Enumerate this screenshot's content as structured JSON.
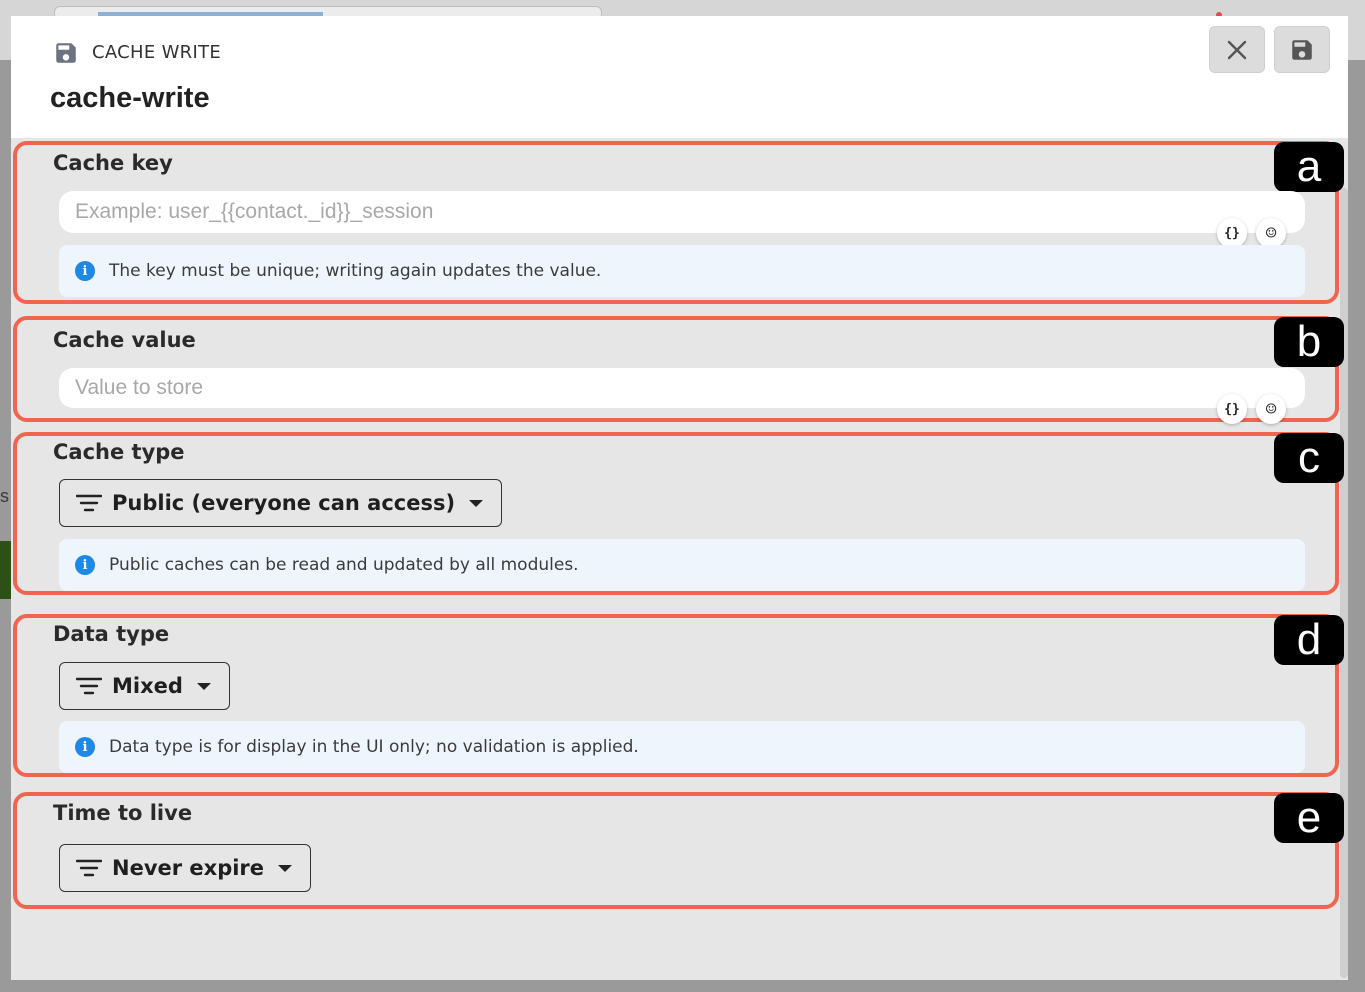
{
  "header": {
    "kicker": "CACHE WRITE",
    "title": "cache-write"
  },
  "sections": {
    "cache_key": {
      "badge": "a",
      "label": "Cache key",
      "placeholder": "Example: user_{{contact._id}}_session",
      "value": "",
      "info": "The key must be unique; writing again updates the value."
    },
    "cache_value": {
      "badge": "b",
      "label": "Cache value",
      "placeholder": "Value to store",
      "value": ""
    },
    "cache_type": {
      "badge": "c",
      "label": "Cache type",
      "selected": "Public (everyone can access)",
      "info": "Public caches can be read and updated by all modules."
    },
    "data_type": {
      "badge": "d",
      "label": "Data type",
      "selected": "Mixed",
      "info": "Data type is for display in the UI only; no validation is applied."
    },
    "time_to_live": {
      "badge": "e",
      "label": "Time to live",
      "selected": "Never expire"
    }
  },
  "mini_buttons": {
    "variable": "{}",
    "emoji": "☺"
  },
  "icons": {
    "header": "floppy-disk-icon",
    "close": "close-icon",
    "save": "floppy-disk-icon",
    "info": "info-icon",
    "filter": "filter-icon",
    "caret": "caret-down-icon",
    "variable": "braces-icon",
    "emoji": "smiley-icon"
  },
  "colors": {
    "highlight_border": "#f06450",
    "badge_bg": "#000000",
    "info_bg": "#eef5fd",
    "info_icon": "#1e88e5",
    "modal_bg": "#e6e6e6"
  }
}
